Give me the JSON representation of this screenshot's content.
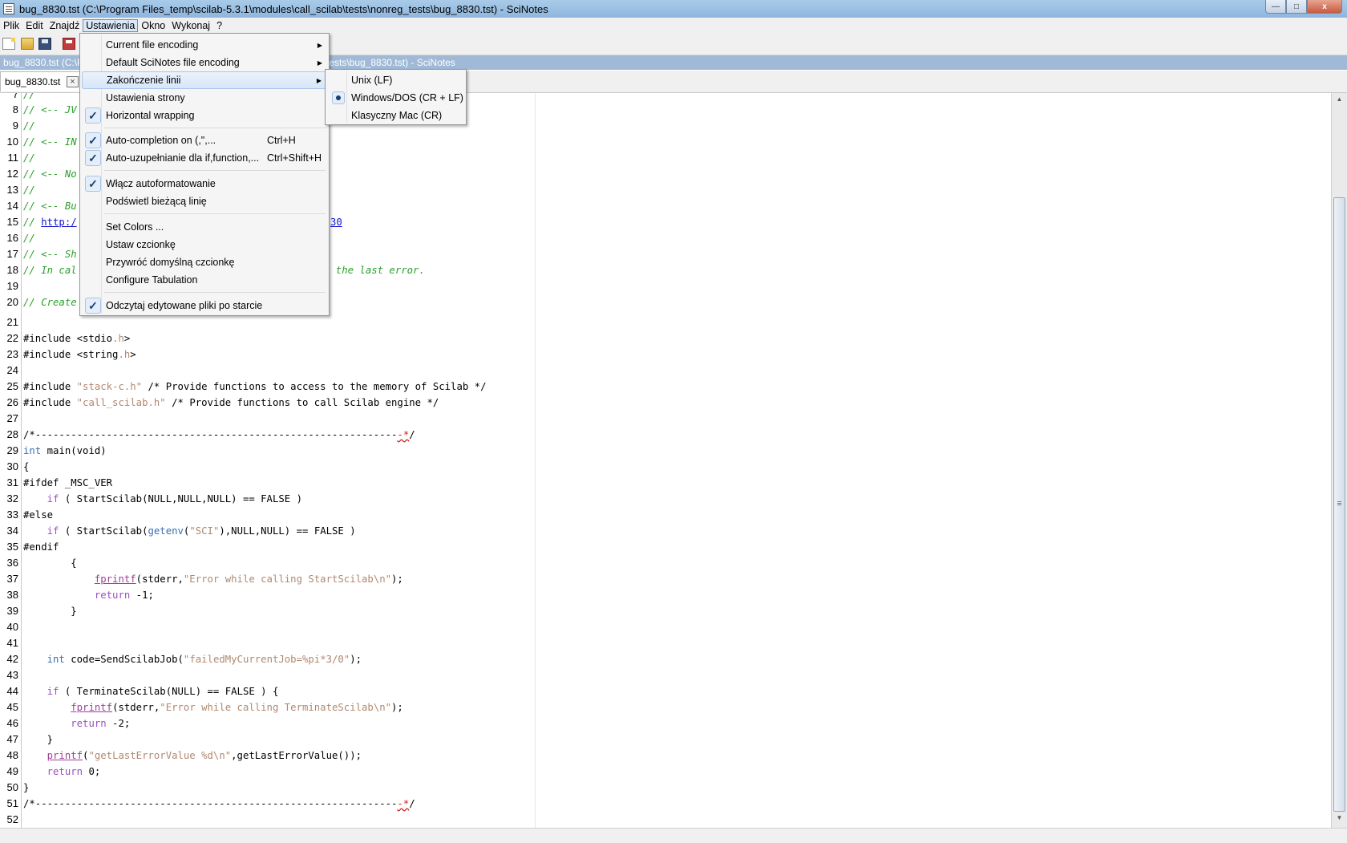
{
  "window": {
    "title": "bug_8830.tst (C:\\Program Files_temp\\scilab-5.3.1\\modules\\call_scilab\\tests\\nonreg_tests\\bug_8830.tst) - SciNotes",
    "min_label": "—",
    "max_label": "□",
    "close_label": "x"
  },
  "menubar": [
    "Plik",
    "Edit",
    "Znajdź",
    "Ustawienia",
    "Okno",
    "Wykonaj",
    "?"
  ],
  "docbar": {
    "left_text": "bug_8830.tst (C:\\Pro",
    "right_text": "tests\\bug_8830.tst) - SciNotes"
  },
  "tab": {
    "label": "bug_8830.tst",
    "close": "×"
  },
  "settings_menu": {
    "items": [
      {
        "label": "Current file encoding",
        "submenu": true
      },
      {
        "label": "Default SciNotes file encoding",
        "submenu": true
      },
      {
        "label": "Zakończenie linii",
        "submenu": true,
        "highlighted": true
      },
      {
        "label": "Ustawienia strony"
      },
      {
        "label": "Horizontal wrapping",
        "checked": true
      },
      {
        "label": "Auto-completion on (,\",...",
        "shortcut": "Ctrl+H",
        "checked": true
      },
      {
        "label": "Auto-uzupełnianie dla if,function,...",
        "shortcut": "Ctrl+Shift+H",
        "checked": true
      },
      {
        "label": "Włącz autoformatowanie",
        "checked": true
      },
      {
        "label": "Podświetl bieżącą linię"
      },
      {
        "label": "Set Colors ..."
      },
      {
        "label": "Ustaw czcionkę"
      },
      {
        "label": "Przywróć domyślną czcionkę"
      },
      {
        "label": "Configure Tabulation"
      },
      {
        "label": "Odczytaj edytowane pliki po starcie",
        "checked": true
      }
    ]
  },
  "line_ending_menu": {
    "items": [
      {
        "label": "Unix (LF)"
      },
      {
        "label": "Windows/DOS (CR + LF)",
        "selected": true
      },
      {
        "label": "Klasyczny Mac (CR)"
      }
    ]
  },
  "line_numbers": [
    "7",
    "8",
    "9",
    "10",
    "11",
    "12",
    "13",
    "14",
    "15",
    "16",
    "17",
    "18",
    "19",
    "20",
    "21",
    "22",
    "23",
    "24",
    "25",
    "26",
    "27",
    "28",
    "29",
    "30",
    "31",
    "32",
    "33",
    "34",
    "35",
    "36",
    "37",
    "38",
    "39",
    "40",
    "41",
    "42",
    "43",
    "44",
    "45",
    "46",
    "47",
    "48",
    "49",
    "50",
    "51",
    "52"
  ],
  "code_lines": [
    {
      "n": "7",
      "text": "//"
    },
    {
      "n": "8",
      "text": "// <-- JV"
    },
    {
      "n": "9",
      "text": "//"
    },
    {
      "n": "10",
      "text": "// <-- IN"
    },
    {
      "n": "11",
      "text": "//"
    },
    {
      "n": "12",
      "text": "// <-- No"
    },
    {
      "n": "13",
      "text": "//"
    },
    {
      "n": "14",
      "text": "// <-- Bu"
    },
    {
      "n": "15",
      "text": "// http:/",
      "tail": "30"
    },
    {
      "n": "16",
      "text": "//"
    },
    {
      "n": "17",
      "text": "// <-- Sh"
    },
    {
      "n": "18",
      "text": "// In cal",
      "tail": "r the last error."
    },
    {
      "n": "19",
      "text": ""
    },
    {
      "n": "20",
      "text": "// Create"
    },
    {
      "n": "21",
      "text": ""
    },
    {
      "n": "22",
      "text": "#include <stdio.h>"
    },
    {
      "n": "23",
      "text": "#include <string.h>"
    },
    {
      "n": "24",
      "text": ""
    },
    {
      "n": "25",
      "text": "#include \"stack-c.h\" /* Provide functions to access to the memory of Scilab */"
    },
    {
      "n": "26",
      "text": "#include \"call_scilab.h\" /* Provide functions to call Scilab engine */"
    },
    {
      "n": "27",
      "text": ""
    },
    {
      "n": "28",
      "text": "/*--------------------------------------------------------------*/"
    },
    {
      "n": "29",
      "text": "int main(void)"
    },
    {
      "n": "30",
      "text": "{"
    },
    {
      "n": "31",
      "text": "#ifdef _MSC_VER"
    },
    {
      "n": "32",
      "text": "    if ( StartScilab(NULL,NULL,NULL) == FALSE )"
    },
    {
      "n": "33",
      "text": "#else"
    },
    {
      "n": "34",
      "text": "    if ( StartScilab(getenv(\"SCI\"),NULL,NULL) == FALSE )"
    },
    {
      "n": "35",
      "text": "#endif"
    },
    {
      "n": "36",
      "text": "        {"
    },
    {
      "n": "37",
      "text": "            fprintf(stderr,\"Error while calling StartScilab\\n\");"
    },
    {
      "n": "38",
      "text": "            return -1;"
    },
    {
      "n": "39",
      "text": "        }"
    },
    {
      "n": "40",
      "text": ""
    },
    {
      "n": "41",
      "text": ""
    },
    {
      "n": "42",
      "text": "    int code=SendScilabJob(\"failedMyCurrentJob=%pi*3/0\");"
    },
    {
      "n": "43",
      "text": ""
    },
    {
      "n": "44",
      "text": "    if ( TerminateScilab(NULL) == FALSE ) {"
    },
    {
      "n": "45",
      "text": "        fprintf(stderr,\"Error while calling TerminateScilab\\n\");"
    },
    {
      "n": "46",
      "text": "        return -2;"
    },
    {
      "n": "47",
      "text": "    }"
    },
    {
      "n": "48",
      "text": "    printf(\"getLastErrorValue %d\\n\",getLastErrorValue());"
    },
    {
      "n": "49",
      "text": "    return 0;"
    },
    {
      "n": "50",
      "text": "}"
    },
    {
      "n": "51",
      "text": "/*--------------------------------------------------------------*/"
    },
    {
      "n": "52",
      "text": ""
    }
  ]
}
